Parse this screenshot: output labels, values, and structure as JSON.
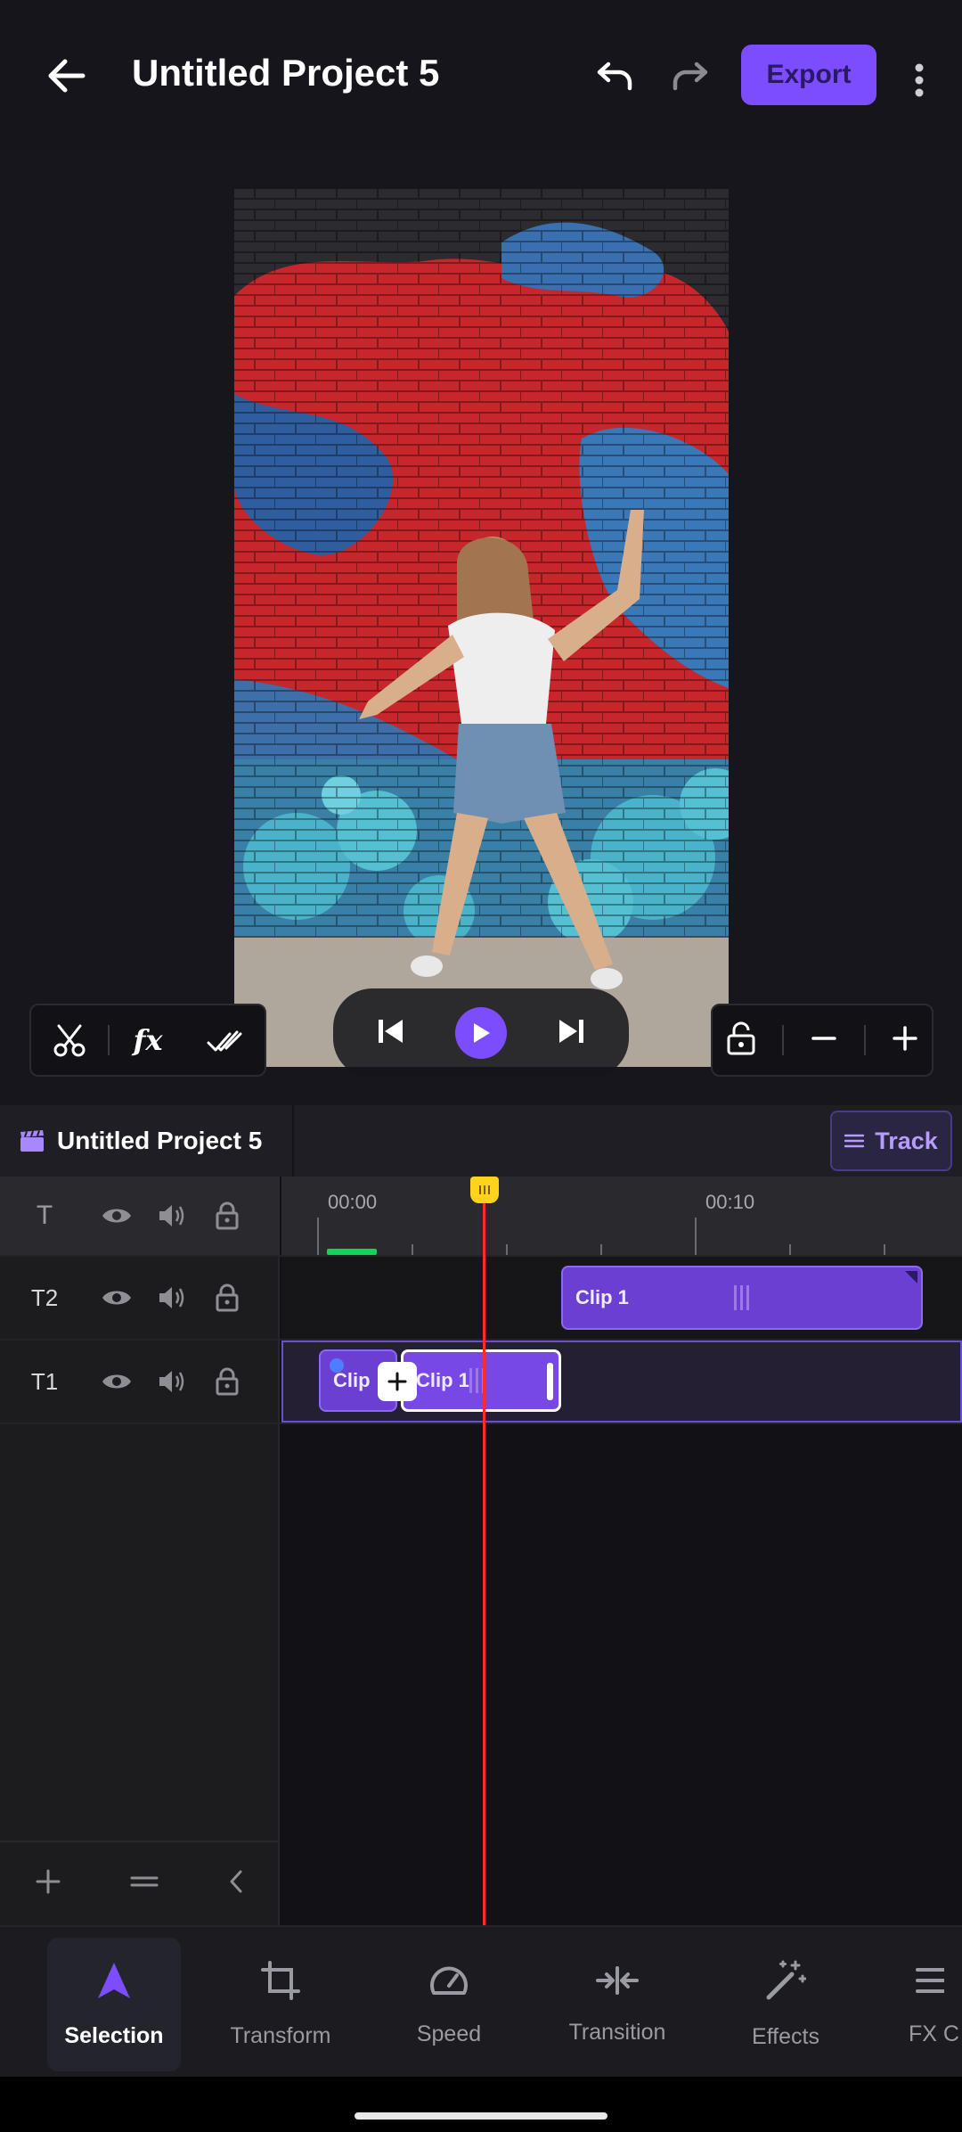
{
  "header": {
    "title": "Untitled Project 5",
    "export_label": "Export"
  },
  "project": {
    "name": "Untitled Project 5",
    "track_label": "Track"
  },
  "timeline": {
    "ruler_labels": [
      "00:00",
      "00:10"
    ],
    "tracks": [
      {
        "label": "T"
      },
      {
        "label": "T2"
      },
      {
        "label": "T1"
      }
    ],
    "clips": {
      "t2_clip": "Clip 1",
      "t1_clip_a": "Clip",
      "t1_clip_b": "Clip 1"
    }
  },
  "bottom_nav": {
    "items": [
      {
        "label": "Selection",
        "icon": "cursor-arrow-icon"
      },
      {
        "label": "Transform",
        "icon": "crop-icon"
      },
      {
        "label": "Speed",
        "icon": "speedometer-icon"
      },
      {
        "label": "Transition",
        "icon": "transition-icon"
      },
      {
        "label": "Effects",
        "icon": "magic-wand-icon"
      },
      {
        "label": "FX C",
        "icon": "fx-icon"
      }
    ]
  },
  "colors": {
    "accent": "#7c4dff",
    "playhead": "#ff2a2a",
    "playhead_handle": "#ffd21c",
    "green_marker": "#17d15a"
  }
}
